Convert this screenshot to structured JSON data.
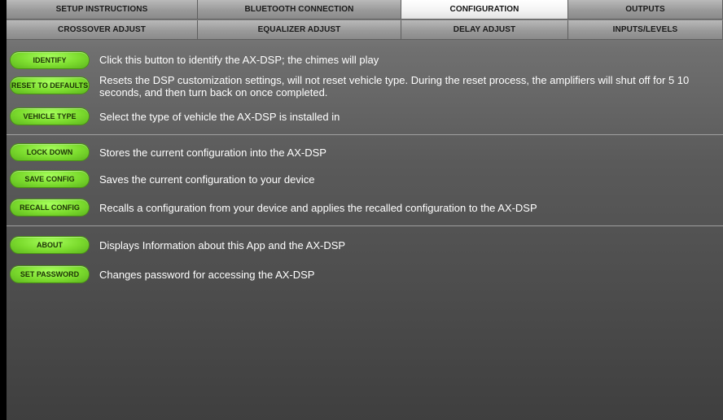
{
  "tabs": {
    "row1": [
      {
        "label": "SETUP INSTRUCTIONS"
      },
      {
        "label": "BLUETOOTH CONNECTION"
      },
      {
        "label": "CONFIGURATION"
      },
      {
        "label": "OUTPUTS"
      }
    ],
    "row2": [
      {
        "label": "CROSSOVER ADJUST"
      },
      {
        "label": "EQUALIZER ADJUST"
      },
      {
        "label": "DELAY ADJUST"
      },
      {
        "label": "INPUTS/LEVELS"
      }
    ],
    "active": "CONFIGURATION"
  },
  "actions": {
    "identify": {
      "label": "IDENTIFY",
      "description": "Click this button to identify the AX-DSP; the chimes will play"
    },
    "reset": {
      "label": "RESET TO DEFAULTS",
      "description": "Resets the DSP customization settings, will not reset vehicle type. During the reset process, the amplifiers will shut off for 5 10 seconds, and then turn back on once completed."
    },
    "vehicle": {
      "label": "VEHICLE TYPE",
      "description": "Select the type of vehicle the AX-DSP is installed in"
    },
    "lock": {
      "label": "LOCK DOWN",
      "description": "Stores the current configuration into the AX-DSP"
    },
    "save": {
      "label": "SAVE CONFIG",
      "description": "Saves the current configuration to your device"
    },
    "recall": {
      "label": "RECALL CONFIG",
      "description": "Recalls a configuration from your device and applies the recalled configuration to the AX-DSP"
    },
    "about": {
      "label": "ABOUT",
      "description": "Displays Information about this App and the AX-DSP"
    },
    "password": {
      "label": "SET PASSWORD",
      "description": "Changes password for accessing the AX-DSP"
    }
  },
  "colors": {
    "button_green": "#7cdc2e",
    "active_tab": "#ffffff"
  }
}
